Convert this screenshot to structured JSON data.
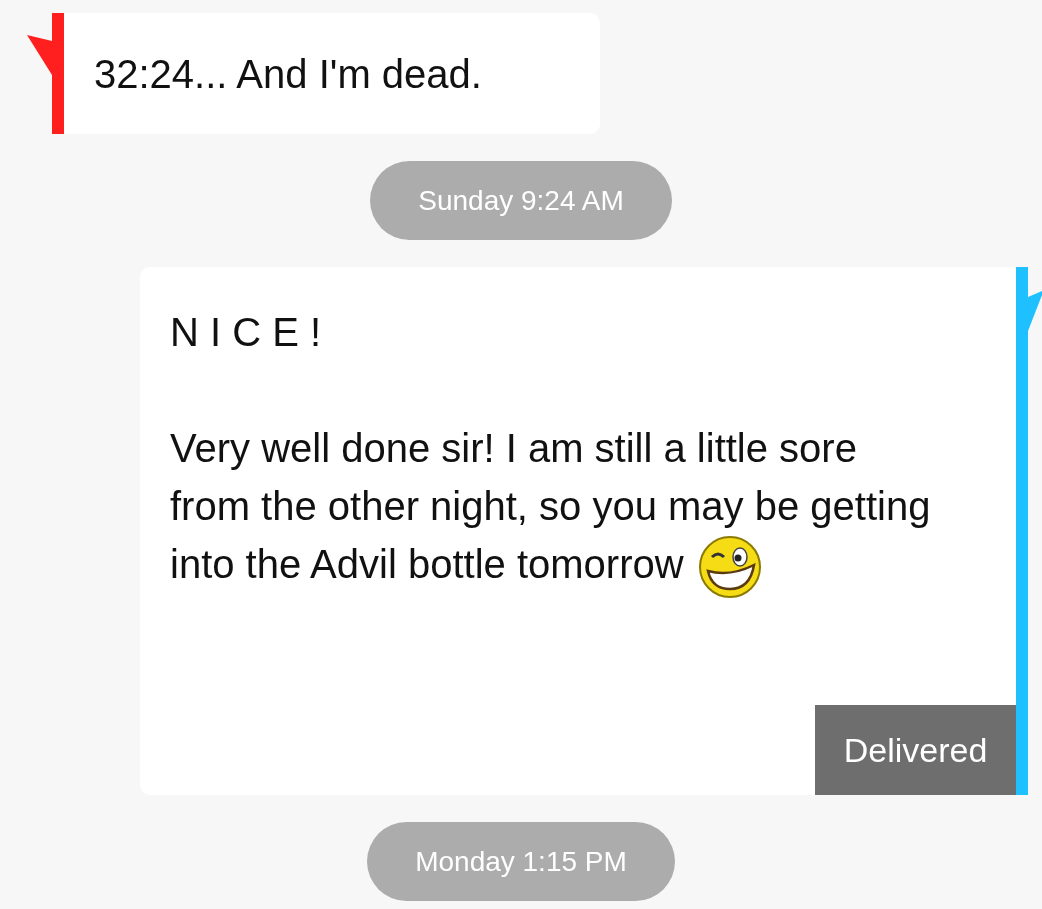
{
  "messages": [
    {
      "kind": "incoming",
      "paragraphs": [
        "32:24... And I'm dead."
      ]
    },
    {
      "kind": "timestamp",
      "text": "Sunday 9:24 AM"
    },
    {
      "kind": "outgoing",
      "paragraphs": [
        "N I C E !",
        "Very well done sir! I am still a little sore from the other night, so you may be getting into the Advil bottle tomorrow"
      ],
      "has_emoji": true,
      "status": "Delivered"
    },
    {
      "kind": "timestamp",
      "text": "Monday 1:15 PM"
    }
  ]
}
